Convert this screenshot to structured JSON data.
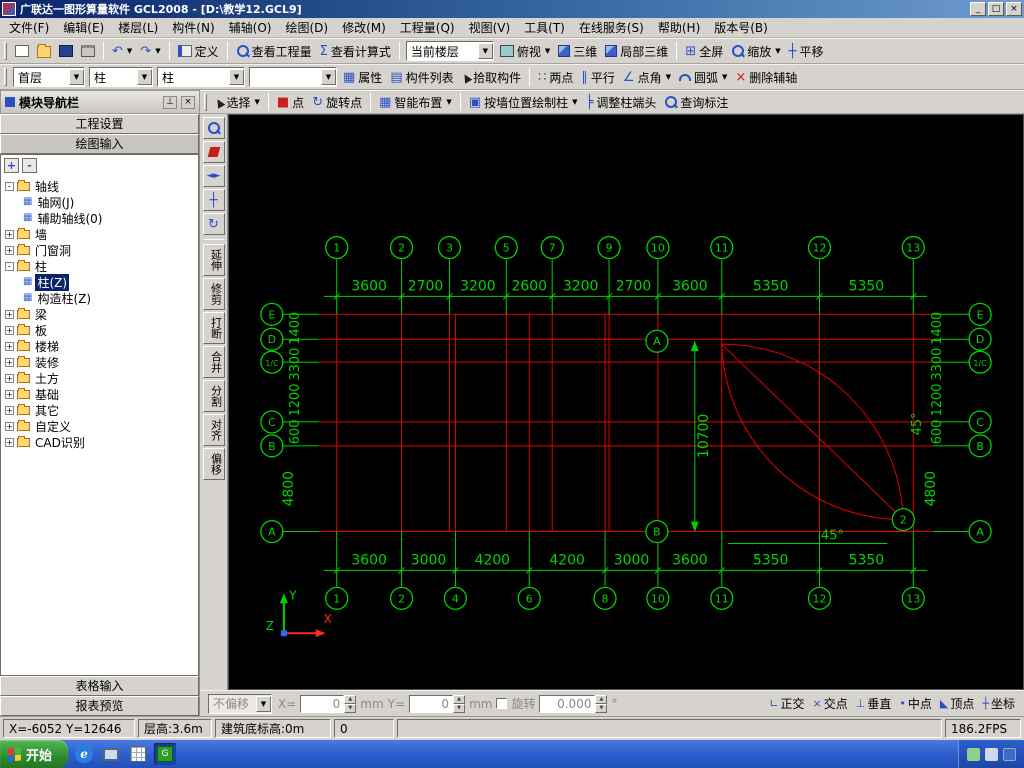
{
  "window": {
    "title": "广联达一图形算量软件 GCL2008 - [D:\\教学12.GCL9]",
    "min": "_",
    "max": "□",
    "close": "×"
  },
  "menus": [
    "文件(F)",
    "编辑(E)",
    "楼层(L)",
    "构件(N)",
    "辅轴(O)",
    "绘图(D)",
    "修改(M)",
    "工程量(Q)",
    "视图(V)",
    "工具(T)",
    "在线服务(S)",
    "帮助(H)",
    "版本号(B)"
  ],
  "toolbar_main": {
    "define": "定义",
    "view_quantity": "查看工程量",
    "view_calc": "查看计算式",
    "current_floor_combo": "当前楼层",
    "top_view": "俯视",
    "three_d": "三维",
    "local_three_d": "局部三维",
    "fullscreen": "全屏",
    "zoom": "缩放",
    "pan": "平移"
  },
  "toolbar_component": {
    "floor": "首层",
    "category": "柱",
    "element": "柱",
    "empty_combo": "",
    "props": "属性",
    "component_list": "构件列表",
    "pick": "拾取构件",
    "two_point": "两点",
    "parallel": "平行",
    "point_angle": "点角",
    "arc": "圆弧",
    "del_aux": "删除辅轴"
  },
  "toolbar_draw": {
    "select": "选择",
    "point": "点",
    "rotate_point": "旋转点",
    "smart": "智能布置",
    "by_wall": "按墙位置绘制柱",
    "adjust_end": "调整柱端头",
    "query_dim": "查询标注"
  },
  "nav": {
    "title": "模块导航栏",
    "btn_project": "工程设置",
    "btn_draw": "绘图输入",
    "btn_plus": "+",
    "btn_minus": "-",
    "btn_table": "表格输入",
    "btn_report": "报表预览",
    "tree": [
      {
        "label": "轴线",
        "type": "folder",
        "expander": "-",
        "level": 0
      },
      {
        "label": "轴网(J)",
        "type": "item",
        "level": 1
      },
      {
        "label": "辅助轴线(0)",
        "type": "item",
        "level": 1
      },
      {
        "label": "墙",
        "type": "folder",
        "expander": "+",
        "level": 0
      },
      {
        "label": "门窗洞",
        "type": "folder",
        "expander": "+",
        "level": 0
      },
      {
        "label": "柱",
        "type": "folder",
        "expander": "-",
        "level": 0
      },
      {
        "label": "柱(Z)",
        "type": "item",
        "level": 1,
        "selected": true
      },
      {
        "label": "构造柱(Z)",
        "type": "item",
        "level": 1
      },
      {
        "label": "梁",
        "type": "folder",
        "expander": "+",
        "level": 0
      },
      {
        "label": "板",
        "type": "folder",
        "expander": "+",
        "level": 0
      },
      {
        "label": "楼梯",
        "type": "folder",
        "expander": "+",
        "level": 0
      },
      {
        "label": "装修",
        "type": "folder",
        "expander": "+",
        "level": 0
      },
      {
        "label": "土方",
        "type": "folder",
        "expander": "+",
        "level": 0
      },
      {
        "label": "基础",
        "type": "folder",
        "expander": "+",
        "level": 0
      },
      {
        "label": "其它",
        "type": "folder",
        "expander": "+",
        "level": 0
      },
      {
        "label": "自定义",
        "type": "folder",
        "expander": "+",
        "level": 0
      },
      {
        "label": "CAD识别",
        "type": "folder",
        "expander": "+",
        "level": 0
      }
    ]
  },
  "side_tools": [
    "延伸",
    "修剪",
    "打断",
    "合并",
    "分割",
    "对齐",
    "偏移"
  ],
  "drawing": {
    "top_axis_labels": [
      "1",
      "2",
      "3",
      "5",
      "7",
      "9",
      "10",
      "11",
      "12",
      "13"
    ],
    "top_dims": [
      "3600",
      "2700",
      "3200",
      "2600",
      "3200",
      "2700",
      "3600",
      "5350",
      "5350"
    ],
    "bottom_axis_labels": [
      "1",
      "2",
      "4",
      "6",
      "8",
      "10",
      "11",
      "12",
      "13"
    ],
    "bottom_dims": [
      "3600",
      "3000",
      "4200",
      "4200",
      "3000",
      "3600",
      "5350",
      "5350"
    ],
    "left_axis_labels": [
      "E",
      "D",
      "1/C",
      "C",
      "B",
      "A"
    ],
    "right_axis_labels": [
      "E",
      "D",
      "1/C",
      "C",
      "B",
      "A"
    ],
    "side_dims": [
      "1400",
      "3300",
      "1200",
      "600"
    ],
    "side_dim_large": "4800",
    "span_dim": "10700",
    "angle_label": "45°",
    "inner_bubbles": [
      "A",
      "B",
      "2"
    ],
    "ucs": {
      "x": "X",
      "y": "Y",
      "z": "Z"
    }
  },
  "coord_bar": {
    "offset_combo": "不偏移",
    "x_label": "X=",
    "x_value": "0",
    "x_unit": "mm",
    "y_label": "Y=",
    "y_value": "0",
    "y_unit": "mm",
    "rotate_label": "旋转",
    "angle_value": "0.000",
    "angle_unit": "°",
    "snap_buttons": [
      "正交",
      "交点",
      "垂直",
      "中点",
      "顶点",
      "坐标"
    ]
  },
  "status_bar": {
    "coords": "X=-6052 Y=12646",
    "floor_height": "层高:3.6m",
    "base_elev": "建筑底标高:0m",
    "zero": "0",
    "fps": "186.2FPS"
  },
  "taskbar": {
    "start": "开始"
  },
  "colors": {
    "grid_red": "#e60000",
    "anno_green": "#00d400",
    "axis_x_red": "#ff2a2a",
    "origin_blue": "#2a6aff",
    "canvas_bg": "#000000"
  }
}
